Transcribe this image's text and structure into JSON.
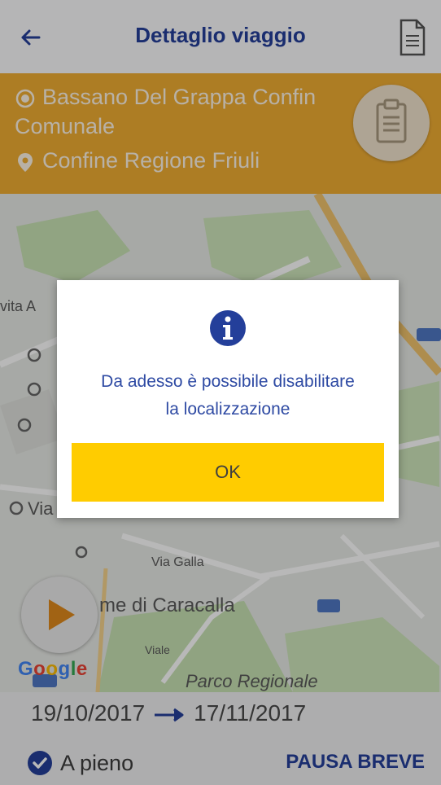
{
  "header": {
    "title": "Dettaglio viaggio",
    "back_icon": "back-arrow-icon",
    "doc_icon": "document-icon"
  },
  "route": {
    "origin_line1": "Bassano Del Grappa Confin",
    "origin_line2": "Comunale",
    "destination": "Confine Regione Friuli",
    "origin_icon": "radio-dot-icon",
    "destination_icon": "location-pin-icon",
    "clipboard_icon": "clipboard-icon"
  },
  "map": {
    "labels": {
      "caracalla": "me di Caracalla",
      "parco": "Parco Regionale",
      "via_galla": "Via Galla",
      "viale": "Viale",
      "via_c": "Via C",
      "vita_a": "vita A"
    },
    "google": "Google"
  },
  "dialog": {
    "message_line1": "Da adesso è possibile disabilitare",
    "message_line2": "la localizzazione",
    "ok_label": "OK",
    "info_icon": "info-icon"
  },
  "footer": {
    "start_date": "19/10/2017",
    "end_date": "17/11/2017",
    "a_pieno_label": "A pieno",
    "pause_label": "PAUSA BREVE"
  },
  "colors": {
    "brand_blue": "#243f9a",
    "route_orange": "#f0ad33",
    "ok_yellow": "#ffcc00"
  }
}
